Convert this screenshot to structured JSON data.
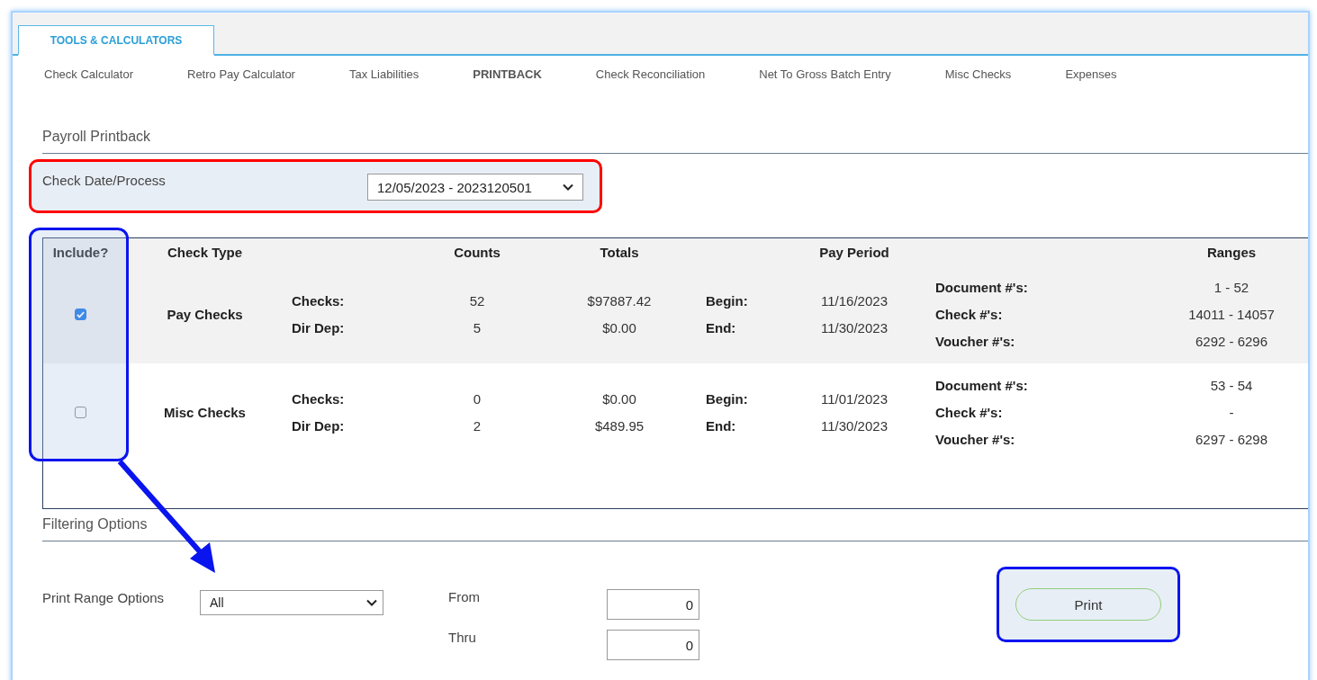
{
  "tabs": [
    {
      "label": "TOOLS & CALCULATORS",
      "selected": true
    }
  ],
  "nav": [
    {
      "label": "Check Calculator",
      "selected": false
    },
    {
      "label": "Retro Pay Calculator",
      "selected": false
    },
    {
      "label": "Tax Liabilities",
      "selected": false
    },
    {
      "label": "PRINTBACK",
      "selected": true
    },
    {
      "label": "Check Reconciliation",
      "selected": false
    },
    {
      "label": "Net To Gross Batch Entry",
      "selected": false
    },
    {
      "label": "Misc Checks",
      "selected": false
    },
    {
      "label": "Expenses",
      "selected": false
    }
  ],
  "section_title": "Payroll Printback",
  "check_date": {
    "label": "Check Date/Process",
    "value": "12/05/2023 - 2023120501"
  },
  "table": {
    "columns": {
      "include": "Include?",
      "check_type": "Check Type",
      "counts": "Counts",
      "totals": "Totals",
      "pay_period": "Pay Period",
      "ranges": "Ranges"
    },
    "rows": [
      {
        "include": true,
        "check_type": "Pay Checks",
        "lines": [
          {
            "label": "Checks:",
            "count": "52",
            "total": "$97887.42"
          },
          {
            "label": "Dir Dep:",
            "count": "5",
            "total": "$0.00"
          }
        ],
        "period": [
          {
            "label": "Begin:",
            "date": "11/16/2023"
          },
          {
            "label": "End:",
            "date": "11/30/2023"
          }
        ],
        "ranges": [
          {
            "label": "Document #'s:",
            "value": "1 - 52"
          },
          {
            "label": "Check #'s:",
            "value": "14011 - 14057"
          },
          {
            "label": "Voucher #'s:",
            "value": "6292 - 6296"
          }
        ]
      },
      {
        "include": false,
        "check_type": "Misc Checks",
        "lines": [
          {
            "label": "Checks:",
            "count": "0",
            "total": "$0.00"
          },
          {
            "label": "Dir Dep:",
            "count": "2",
            "total": "$489.95"
          }
        ],
        "period": [
          {
            "label": "Begin:",
            "date": "11/01/2023"
          },
          {
            "label": "End:",
            "date": "11/30/2023"
          }
        ],
        "ranges": [
          {
            "label": "Document #'s:",
            "value": "53 - 54"
          },
          {
            "label": "Check #'s:",
            "value": "-"
          },
          {
            "label": "Voucher #'s:",
            "value": "6297 - 6298"
          }
        ]
      }
    ]
  },
  "filter_title": "Filtering Options",
  "print_range": {
    "label": "Print Range Options",
    "value": "All"
  },
  "from": {
    "label": "From",
    "value": "0"
  },
  "thru": {
    "label": "Thru",
    "value": "0"
  },
  "print_button": "Print"
}
